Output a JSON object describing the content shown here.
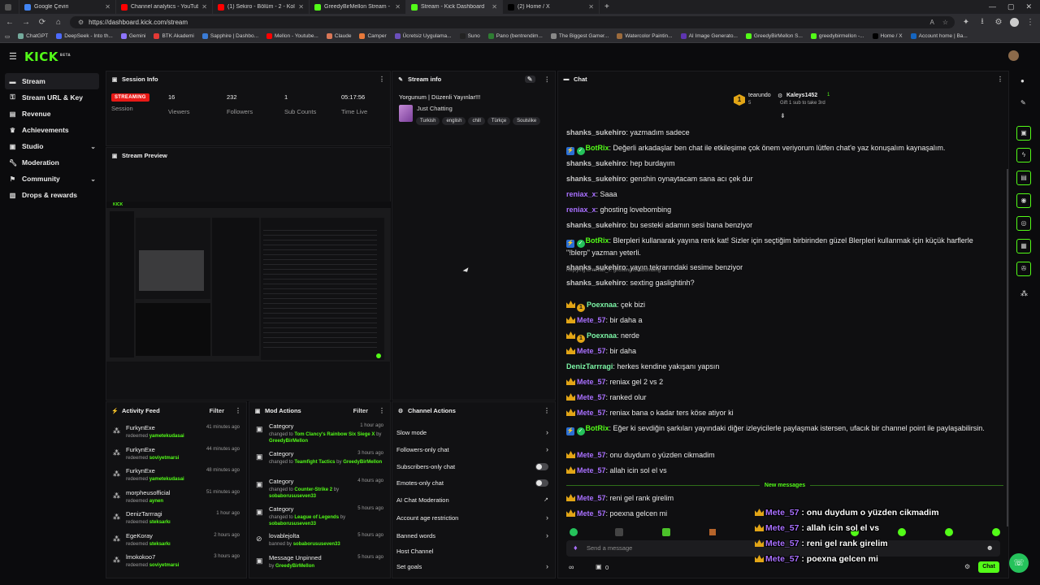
{
  "browser": {
    "tabs": [
      {
        "title": "Google Çeviri",
        "color": "#4285f4"
      },
      {
        "title": "Channel analytics - YouTube Studio",
        "color": "#ff0000"
      },
      {
        "title": "(1) Sekiro - Bölüm - 2 - Kolay Boss",
        "color": "#ff0000"
      },
      {
        "title": "GreedyBirMellon Stream - Watch",
        "color": "#53fc18"
      },
      {
        "title": "Stream - Kick Dashboard",
        "color": "#53fc18",
        "active": true
      },
      {
        "title": "(2) Home / X",
        "color": "#000000"
      }
    ],
    "url": "https://dashboard.kick.com/stream",
    "bookmarks": [
      "ChatGPT",
      "DeepSeek - Into th...",
      "Gemini",
      "BTK Akademi",
      "Sapphire | Dashbo...",
      "Mellon - Youtube...",
      "Claude",
      "Camper",
      "Ücretsiz Uygulama...",
      "Suno",
      "Pano (bentrendim...",
      "The Biggest Gamer...",
      "Watercolor Paintin...",
      "AI Image Generato...",
      "GreedyBirMellon S...",
      "greedybirmellon -...",
      "Home / X",
      "Account home | Ba..."
    ]
  },
  "brand": {
    "logo": "KICK",
    "logo_sup": "BETA",
    "accent": "#53fc18"
  },
  "sidebar": {
    "items": [
      {
        "label": "Stream",
        "icon": "stream-icon"
      },
      {
        "label": "Stream URL & Key",
        "icon": "key-icon"
      },
      {
        "label": "Revenue",
        "icon": "revenue-icon"
      },
      {
        "label": "Achievements",
        "icon": "trophy-icon"
      },
      {
        "label": "Studio",
        "icon": "studio-icon"
      },
      {
        "label": "Moderation",
        "icon": "wrench-icon"
      },
      {
        "label": "Community",
        "icon": "community-icon"
      },
      {
        "label": "Drops & rewards",
        "icon": "gift-icon"
      }
    ]
  },
  "session": {
    "title": "Session Info",
    "status": "STREAMING",
    "status_label": "Session",
    "stats": [
      {
        "value": "16",
        "label": "Viewers"
      },
      {
        "value": "232",
        "label": "Followers"
      },
      {
        "value": "1",
        "label": "Sub Counts"
      },
      {
        "value": "05:17:56",
        "label": "Time Live"
      }
    ]
  },
  "stream_info": {
    "title": "Stream info",
    "stream_title": "Yorgunum | Düzenli Yayınlar!!!",
    "category": "Just Chatting",
    "tags": [
      "Turkish",
      "english",
      "chill",
      "Türkçe",
      "Soulslike"
    ]
  },
  "preview": {
    "title": "Stream Preview"
  },
  "activity": {
    "title": "Activity Feed",
    "filter": "Filter",
    "rows": [
      {
        "name": "FurkynExe",
        "action": "redeemed",
        "reward": "yametekudasai",
        "time": "41 minutes ago"
      },
      {
        "name": "FurkynExe",
        "action": "redeemed",
        "reward": "soviyetmarsi",
        "time": "44 minutes ago"
      },
      {
        "name": "FurkynExe",
        "action": "redeemed",
        "reward": "yametekudasai",
        "time": "48 minutes ago"
      },
      {
        "name": "morpheusofficial",
        "action": "redeemed",
        "reward": "aynen",
        "time": "51 minutes ago"
      },
      {
        "name": "DenizTarrragi",
        "action": "redeemed",
        "reward": "steksarkı",
        "time": "1 hour ago"
      },
      {
        "name": "EgeKoray",
        "action": "redeemed",
        "reward": "steksarkı",
        "time": "2 hours ago"
      },
      {
        "name": "lmokokoo7",
        "action": "redeemed",
        "reward": "soviyetmarsi",
        "time": "3 hours ago"
      }
    ]
  },
  "mod_actions": {
    "title": "Mod Actions",
    "filter": "Filter",
    "rows": [
      {
        "name": "Category",
        "pre": "changed to",
        "target": "Tom Clancy's Rainbow Six Siege X",
        "mid": "by",
        "by": "GreedyBirMellon",
        "time": "1 hour ago"
      },
      {
        "name": "Category",
        "pre": "changed to",
        "target": "Teamfight Tactics",
        "mid": "by",
        "by": "GreedyBirMellon",
        "time": "3 hours ago"
      },
      {
        "name": "Category",
        "pre": "changed to",
        "target": "Counter-Strike 2",
        "mid": "by",
        "by": "sobaborususeven33",
        "time": "4 hours ago"
      },
      {
        "name": "Category",
        "pre": "changed to",
        "target": "League of Legends",
        "mid": "by",
        "by": "sobaborususeven33",
        "time": "5 hours ago"
      },
      {
        "name": "lovablejolta",
        "pre": "banned by",
        "target": "sobaborususeven33",
        "mid": "",
        "by": "",
        "time": "5 hours ago"
      },
      {
        "name": "Message Unpinned",
        "pre": "by",
        "target": "GreedyBirMellon",
        "mid": "",
        "by": "",
        "time": "5 hours ago"
      }
    ]
  },
  "channel_actions": {
    "title": "Channel Actions",
    "rows": [
      "Slow mode",
      "Followers-only chat",
      "Subscribers-only chat",
      "Emotes-only chat",
      "AI Chat Moderation",
      "Account age restriction",
      "Banned words",
      "Host Channel",
      "Set goals"
    ]
  },
  "chat": {
    "title": "Chat",
    "top_gifter": {
      "name": "tearundo",
      "count": "5"
    },
    "leader": {
      "name": "Kaleys1452",
      "count": "1",
      "note": "Gift 1 sub to take 3rd"
    },
    "messages": [
      {
        "user": "shanks_sukehiro",
        "text": ": yazmadım sadece",
        "color": "grey"
      },
      {
        "user": "BotRix",
        "text": ": Değerli arkadaşlar ben chat ile etkileşime çok önem veriyorum lütfen chat'e yaz konuşalım kaynaşalım.",
        "color": "green",
        "bot": true
      },
      {
        "user": "shanks_sukehiro",
        "text": ": hep burdayım",
        "color": "grey"
      },
      {
        "user": "shanks_sukehiro",
        "text": ": genshin oynaytacam sana acı çek dur",
        "color": "grey"
      },
      {
        "user": "reniax_x",
        "text": ": Saaa",
        "color": "purple"
      },
      {
        "user": "reniax_x",
        "text": ": ghosting lovebombing",
        "color": "purple"
      },
      {
        "user": "shanks_sukehiro",
        "text": ": bu sesteki adamın sesi bana benziyor",
        "color": "grey"
      },
      {
        "user": "BotRix",
        "text": ": Blerpleri kullanarak yayına renk kat! Sizler için seçtiğim birbirinden güzel Blerpleri kullanmak için küçük harflerle \"!blerp\" yazman yeterli.",
        "color": "green",
        "bot": true
      },
      {
        "user": "shanks_sukehiro",
        "text": ": yayın tekrarındaki sesime benziyor",
        "color": "grey"
      },
      {
        "reply": "Replying to reniax_x: ghosting lovebombing",
        "user": "shanks_sukehiro",
        "text": ": sexting gaslightinh?",
        "color": "grey"
      },
      {
        "user": "Poexnaa",
        "text": ": çek bizi",
        "color": "mint",
        "crown": true,
        "one": true
      },
      {
        "user": "Mete_57",
        "text": ": bir daha a",
        "color": "purple",
        "crown": true
      },
      {
        "user": "Poexnaa",
        "text": ": nerde",
        "color": "mint",
        "crown": true,
        "one": true
      },
      {
        "user": "Mete_57",
        "text": ": bir daha",
        "color": "purple",
        "crown": true
      },
      {
        "user": "DenizTarrragi",
        "text": ": herkes kendine yakışanı yapsın",
        "color": "mint"
      },
      {
        "user": "Mete_57",
        "text": ": reniax gel 2 vs 2",
        "color": "purple",
        "crown": true
      },
      {
        "user": "Mete_57",
        "text": ": ranked olur",
        "color": "purple",
        "crown": true
      },
      {
        "user": "Mete_57",
        "text": ": reniax bana o kadar ters köse atiyor ki",
        "color": "purple",
        "crown": true
      },
      {
        "user": "BotRix",
        "text": ": Eğer ki sevdiğin şarkıları yayındaki diğer izleyicilerle paylaşmak istersen, ufacık bir channel point ile paylaşabilirsin.",
        "color": "green",
        "bot": true
      },
      {
        "user": "Mete_57",
        "text": ": onu duydum o yüzden cikmadim",
        "color": "purple",
        "crown": true
      },
      {
        "user": "Mete_57",
        "text": ": allah icin sol el vs",
        "color": "purple",
        "crown": true
      }
    ],
    "new_messages": "New messages",
    "after_new": [
      {
        "user": "Mete_57",
        "text": ": reni gel rank girelim",
        "color": "purple",
        "crown": true
      },
      {
        "user": "Mete_57",
        "text": ": poexna gelcen mi",
        "color": "purple",
        "crown": true
      }
    ],
    "overlay": [
      {
        "user": "Mete_57",
        "text": " : onu duydum o yüzden cikmadim"
      },
      {
        "user": "Mete_57",
        "text": " : allah icin sol el vs"
      },
      {
        "user": "Mete_57",
        "text": " : reni gel rank girelim"
      },
      {
        "user": "Mete_57",
        "text": " : poexna gelcen mi"
      }
    ],
    "input_placeholder": "Send a message",
    "points": "0",
    "send_label": "Chat"
  }
}
